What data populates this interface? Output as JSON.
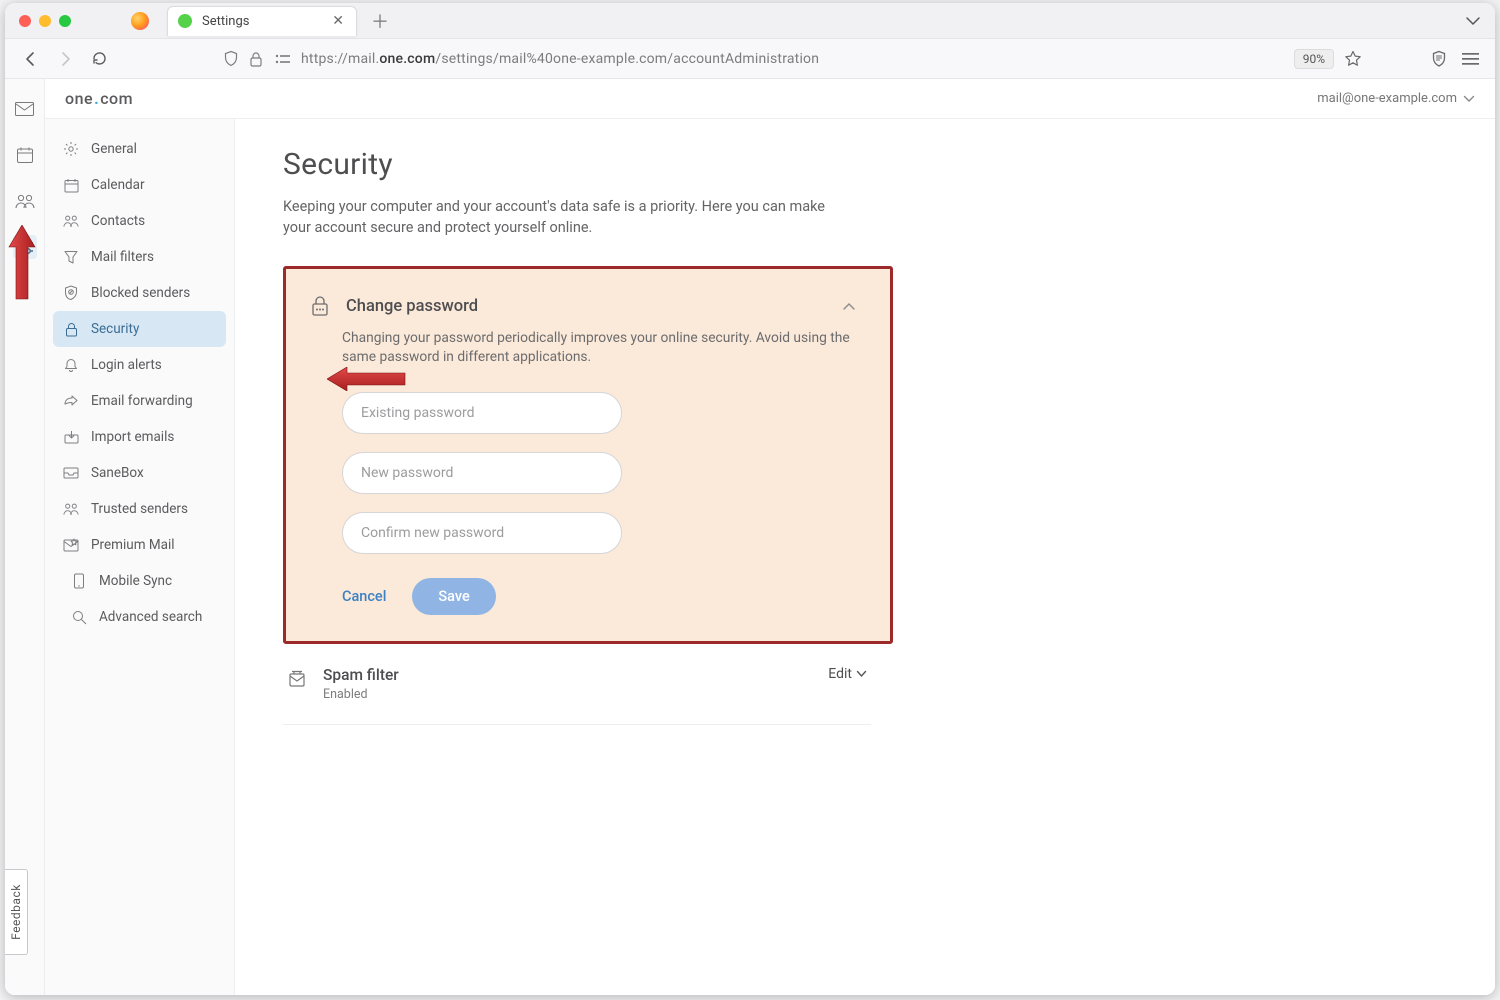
{
  "browser": {
    "tab_title": "Settings",
    "url_prefix": "https://mail.",
    "url_host": "one.com",
    "url_path": "/settings/mail%40one-example.com/accountAdministration",
    "zoom": "90%"
  },
  "header": {
    "brand_pre": "one",
    "brand_dot": ".",
    "brand_post": "com",
    "account_email": "mail@one-example.com"
  },
  "sidebar": {
    "items": [
      {
        "label": "General"
      },
      {
        "label": "Calendar"
      },
      {
        "label": "Contacts"
      },
      {
        "label": "Mail filters"
      },
      {
        "label": "Blocked senders"
      },
      {
        "label": "Security"
      },
      {
        "label": "Login alerts"
      },
      {
        "label": "Email forwarding"
      },
      {
        "label": "Import emails"
      },
      {
        "label": "SaneBox"
      },
      {
        "label": "Trusted senders"
      },
      {
        "label": "Premium Mail"
      }
    ],
    "sub_items": [
      {
        "label": "Mobile Sync"
      },
      {
        "label": "Advanced search"
      }
    ]
  },
  "page": {
    "title": "Security",
    "description": "Keeping your computer and your account's data safe is a priority. Here you can make your account secure and protect yourself online."
  },
  "password_card": {
    "title": "Change password",
    "note": "Changing your password periodically improves your online security. Avoid using the same password in different applications.",
    "placeholders": {
      "existing": "Existing password",
      "new": "New password",
      "confirm": "Confirm new password"
    },
    "cancel_label": "Cancel",
    "save_label": "Save"
  },
  "spam_section": {
    "title": "Spam filter",
    "status": "Enabled",
    "action": "Edit"
  },
  "feedback_label": "Feedback"
}
